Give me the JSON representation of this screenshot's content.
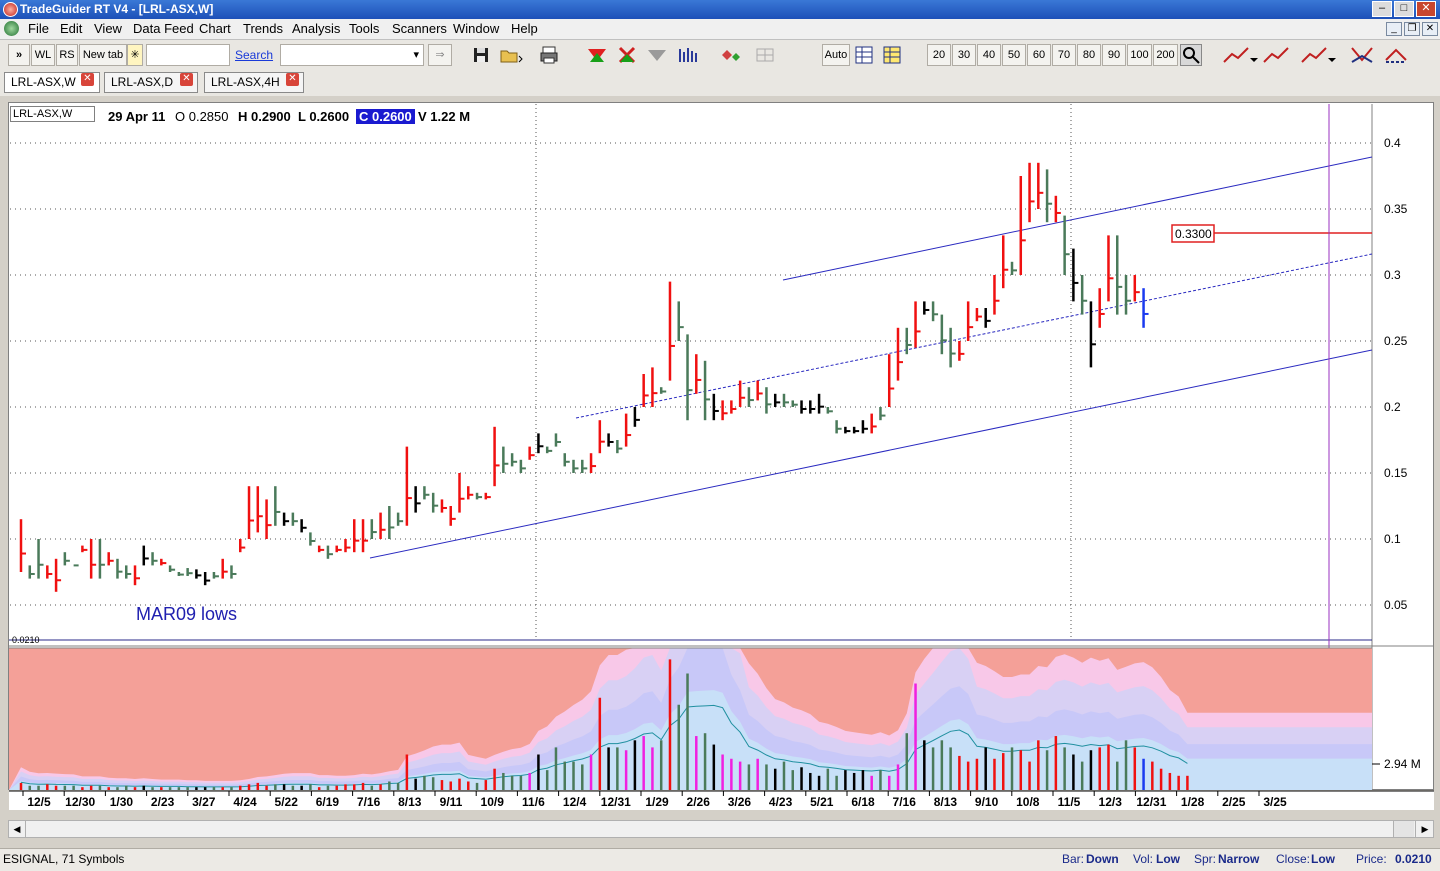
{
  "window": {
    "title": "TradeGuider RT V4  - [LRL-ASX,W]",
    "min": "–",
    "max": "□",
    "close": "✕"
  },
  "menu": [
    "File",
    "Edit",
    "View",
    "Data Feed",
    "Chart",
    "Trends",
    "Analysis",
    "Tools",
    "Scanners",
    "Window",
    "Help"
  ],
  "toolbar": {
    "nav": "»",
    "wl": "WL",
    "rs": "RS",
    "new_tab": "New tab",
    "search_link": "Search",
    "go": "⇒",
    "auto": "Auto",
    "bar_counts": [
      "20",
      "30",
      "40",
      "50",
      "60",
      "70",
      "80",
      "90",
      "100",
      "200"
    ],
    "icons": [
      "save-icon",
      "open-icon",
      "print-icon",
      "zoom-icon"
    ]
  },
  "tabs": [
    {
      "label": "LRL-ASX,W",
      "close": "✕"
    },
    {
      "label": "LRL-ASX,D",
      "close": "✕"
    },
    {
      "label": "LRL-ASX,4H",
      "close": "✕"
    }
  ],
  "chart_header": {
    "symbol": "LRL-ASX,W",
    "date": "29 Apr 11",
    "open": "O 0.2850",
    "high": "H 0.2900",
    "low": "L 0.2600",
    "close": "C 0.2600",
    "volume": "V 1.22 M"
  },
  "price_label": "0.3300",
  "annotation": "MAR09 lows",
  "low_axis_label": "0.0210",
  "volume_axis_label": "2.94 M",
  "chart_data": {
    "type": "bar",
    "y_ticks": [
      0.4,
      0.35,
      0.3,
      0.25,
      0.2,
      0.15,
      0.1,
      0.05
    ],
    "x_ticks": [
      "12/5",
      "12/30",
      "1/30",
      "2/23",
      "3/27",
      "4/24",
      "5/22",
      "6/19",
      "7/16",
      "8/13",
      "9/11",
      "10/9",
      "11/6",
      "12/4",
      "12/31",
      "1/29",
      "2/26",
      "3/26",
      "4/23",
      "5/21",
      "6/18",
      "7/16",
      "8/13",
      "9/10",
      "10/8",
      "11/5",
      "12/3",
      "12/31",
      "1/28",
      "2/25",
      "3/25"
    ],
    "ylim": [
      0.021,
      0.42
    ],
    "bars": [
      [
        0.115,
        0.075,
        "r"
      ],
      [
        0.08,
        0.07,
        "g"
      ],
      [
        0.1,
        0.07,
        "g"
      ],
      [
        0.08,
        0.07,
        "r"
      ],
      [
        0.085,
        0.06,
        "r"
      ],
      [
        0.09,
        0.08,
        "g"
      ],
      [
        0.08,
        0.08,
        "g"
      ],
      [
        0.095,
        0.09,
        "r"
      ],
      [
        0.1,
        0.07,
        "r"
      ],
      [
        0.1,
        0.07,
        "g"
      ],
      [
        0.09,
        0.08,
        "r"
      ],
      [
        0.085,
        0.07,
        "g"
      ],
      [
        0.08,
        0.07,
        "g"
      ],
      [
        0.08,
        0.065,
        "r"
      ],
      [
        0.095,
        0.08,
        "k"
      ],
      [
        0.09,
        0.08,
        "g"
      ],
      [
        0.085,
        0.08,
        "r"
      ],
      [
        0.08,
        0.075,
        "g"
      ],
      [
        0.075,
        0.072,
        "g"
      ],
      [
        0.078,
        0.072,
        "g"
      ],
      [
        0.077,
        0.07,
        "k"
      ],
      [
        0.075,
        0.065,
        "k"
      ],
      [
        0.075,
        0.07,
        "g"
      ],
      [
        0.085,
        0.07,
        "r"
      ],
      [
        0.08,
        0.07,
        "g"
      ],
      [
        0.1,
        0.09,
        "r"
      ],
      [
        0.14,
        0.1,
        "r"
      ],
      [
        0.14,
        0.105,
        "r"
      ],
      [
        0.13,
        0.1,
        "r"
      ],
      [
        0.14,
        0.11,
        "g"
      ],
      [
        0.12,
        0.11,
        "k"
      ],
      [
        0.12,
        0.11,
        "g"
      ],
      [
        0.115,
        0.105,
        "k"
      ],
      [
        0.105,
        0.095,
        "g"
      ],
      [
        0.095,
        0.09,
        "r"
      ],
      [
        0.095,
        0.085,
        "g"
      ],
      [
        0.095,
        0.09,
        "r"
      ],
      [
        0.1,
        0.09,
        "r"
      ],
      [
        0.115,
        0.09,
        "r"
      ],
      [
        0.115,
        0.09,
        "r"
      ],
      [
        0.115,
        0.1,
        "g"
      ],
      [
        0.12,
        0.1,
        "r"
      ],
      [
        0.125,
        0.1,
        "g"
      ],
      [
        0.12,
        0.11,
        "g"
      ],
      [
        0.17,
        0.11,
        "r"
      ],
      [
        0.14,
        0.12,
        "k"
      ],
      [
        0.14,
        0.13,
        "g"
      ],
      [
        0.135,
        0.12,
        "g"
      ],
      [
        0.13,
        0.12,
        "r"
      ],
      [
        0.125,
        0.11,
        "r"
      ],
      [
        0.15,
        0.12,
        "r"
      ],
      [
        0.14,
        0.13,
        "r"
      ],
      [
        0.135,
        0.13,
        "g"
      ],
      [
        0.135,
        0.13,
        "r"
      ],
      [
        0.185,
        0.14,
        "r"
      ],
      [
        0.17,
        0.15,
        "g"
      ],
      [
        0.165,
        0.155,
        "g"
      ],
      [
        0.16,
        0.15,
        "g"
      ],
      [
        0.17,
        0.16,
        "r"
      ],
      [
        0.18,
        0.165,
        "k"
      ],
      [
        0.17,
        0.165,
        "g"
      ],
      [
        0.18,
        0.17,
        "g"
      ],
      [
        0.165,
        0.155,
        "g"
      ],
      [
        0.16,
        0.15,
        "g"
      ],
      [
        0.16,
        0.15,
        "g"
      ],
      [
        0.165,
        0.15,
        "r"
      ],
      [
        0.19,
        0.165,
        "r"
      ],
      [
        0.18,
        0.17,
        "k"
      ],
      [
        0.175,
        0.165,
        "g"
      ],
      [
        0.195,
        0.17,
        "r"
      ],
      [
        0.2,
        0.185,
        "k"
      ],
      [
        0.225,
        0.2,
        "r"
      ],
      [
        0.23,
        0.2,
        "r"
      ],
      [
        0.215,
        0.21,
        "g"
      ],
      [
        0.295,
        0.22,
        "r"
      ],
      [
        0.28,
        0.25,
        "g"
      ],
      [
        0.255,
        0.19,
        "g"
      ],
      [
        0.24,
        0.21,
        "r"
      ],
      [
        0.235,
        0.19,
        "g"
      ],
      [
        0.21,
        0.19,
        "k"
      ],
      [
        0.205,
        0.19,
        "r"
      ],
      [
        0.205,
        0.195,
        "r"
      ],
      [
        0.22,
        0.2,
        "r"
      ],
      [
        0.215,
        0.2,
        "g"
      ],
      [
        0.22,
        0.205,
        "r"
      ],
      [
        0.215,
        0.195,
        "g"
      ],
      [
        0.21,
        0.2,
        "k"
      ],
      [
        0.21,
        0.2,
        "g"
      ],
      [
        0.205,
        0.2,
        "g"
      ],
      [
        0.205,
        0.195,
        "k"
      ],
      [
        0.205,
        0.195,
        "k"
      ],
      [
        0.21,
        0.195,
        "k"
      ],
      [
        0.2,
        0.195,
        "g"
      ],
      [
        0.19,
        0.18,
        "g"
      ],
      [
        0.185,
        0.18,
        "k"
      ],
      [
        0.185,
        0.18,
        "k"
      ],
      [
        0.19,
        0.18,
        "k"
      ],
      [
        0.195,
        0.18,
        "r"
      ],
      [
        0.2,
        0.19,
        "g"
      ],
      [
        0.24,
        0.2,
        "r"
      ],
      [
        0.26,
        0.22,
        "r"
      ],
      [
        0.26,
        0.24,
        "g"
      ],
      [
        0.28,
        0.245,
        "r"
      ],
      [
        0.28,
        0.27,
        "k"
      ],
      [
        0.28,
        0.265,
        "g"
      ],
      [
        0.27,
        0.24,
        "g"
      ],
      [
        0.26,
        0.23,
        "g"
      ],
      [
        0.25,
        0.235,
        "r"
      ],
      [
        0.28,
        0.25,
        "r"
      ],
      [
        0.275,
        0.265,
        "r"
      ],
      [
        0.275,
        0.26,
        "k"
      ],
      [
        0.3,
        0.27,
        "r"
      ],
      [
        0.33,
        0.29,
        "r"
      ],
      [
        0.31,
        0.3,
        "g"
      ],
      [
        0.375,
        0.3,
        "r"
      ],
      [
        0.385,
        0.34,
        "r"
      ],
      [
        0.385,
        0.35,
        "r"
      ],
      [
        0.38,
        0.34,
        "g"
      ],
      [
        0.36,
        0.34,
        "r"
      ],
      [
        0.345,
        0.3,
        "g"
      ],
      [
        0.32,
        0.28,
        "k"
      ],
      [
        0.3,
        0.27,
        "g"
      ],
      [
        0.28,
        0.23,
        "k"
      ],
      [
        0.29,
        0.26,
        "r"
      ],
      [
        0.33,
        0.28,
        "r"
      ],
      [
        0.33,
        0.27,
        "g"
      ],
      [
        0.3,
        0.27,
        "g"
      ],
      [
        0.3,
        0.28,
        "r"
      ],
      [
        0.29,
        0.26,
        "b"
      ]
    ],
    "volumes": [
      0.05,
      0.03,
      0.03,
      0.04,
      0.03,
      0.03,
      0.03,
      0.02,
      0.03,
      0.03,
      0.02,
      0.02,
      0.03,
      0.02,
      0.03,
      0.02,
      0.02,
      0.02,
      0.02,
      0.02,
      0.02,
      0.02,
      0.02,
      0.02,
      0.02,
      0.03,
      0.04,
      0.05,
      0.03,
      0.04,
      0.04,
      0.03,
      0.03,
      0.04,
      0.02,
      0.03,
      0.03,
      0.04,
      0.04,
      0.05,
      0.03,
      0.04,
      0.06,
      0.05,
      0.25,
      0.08,
      0.1,
      0.09,
      0.07,
      0.06,
      0.08,
      0.06,
      0.05,
      0.07,
      0.15,
      0.12,
      0.1,
      0.1,
      0.12,
      0.25,
      0.14,
      0.3,
      0.2,
      0.2,
      0.18,
      0.25,
      0.65,
      0.3,
      0.3,
      0.28,
      0.35,
      0.38,
      0.3,
      0.35,
      0.92,
      0.6,
      0.82,
      0.38,
      0.4,
      0.32,
      0.25,
      0.22,
      0.2,
      0.18,
      0.22,
      0.18,
      0.15,
      0.2,
      0.14,
      0.16,
      0.12,
      0.1,
      0.15,
      0.1,
      0.14,
      0.12,
      0.14,
      0.1,
      0.14,
      0.1,
      0.18,
      0.4,
      0.75,
      0.35,
      0.3,
      0.35,
      0.3,
      0.24,
      0.2,
      0.22,
      0.3,
      0.22,
      0.26,
      0.3,
      0.28,
      0.2,
      0.35,
      0.28,
      0.38,
      0.3,
      0.25,
      0.2,
      0.28,
      0.3,
      0.32,
      0.2,
      0.35,
      0.3,
      0.22,
      0.2,
      0.15,
      0.12,
      0.1,
      0.1
    ]
  },
  "status": {
    "left": "ESIGNAL, 71 Symbols",
    "bar_label": "Bar:",
    "bar_val": "Down",
    "vol_label": "Vol:",
    "vol_val": "Low",
    "spr_label": "Spr:",
    "spr_val": "Narrow",
    "close_label": "Close:",
    "close_val": "Low",
    "price_label": "Price:",
    "price_val": "0.0210"
  }
}
